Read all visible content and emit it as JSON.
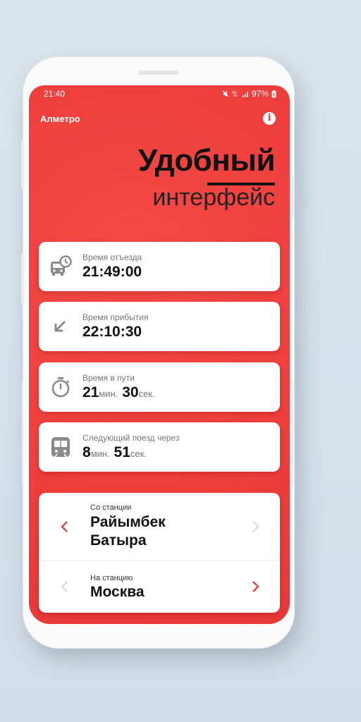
{
  "status_bar": {
    "time": "21:40",
    "battery": "97%"
  },
  "app": {
    "title": "Алметро"
  },
  "headline": {
    "line1": "Удобный",
    "line2": "интерфейс"
  },
  "cards": [
    {
      "icon": "bus-clock-icon",
      "label": "Время отъезда",
      "value": "21:49:00"
    },
    {
      "icon": "arrow-down-left-icon",
      "label": "Время прибытия",
      "value": "22:10:30"
    },
    {
      "icon": "stopwatch-icon",
      "label": "Время в пути",
      "minutes": "21",
      "min_unit": "мин.",
      "seconds": "30",
      "sec_unit": "сек."
    },
    {
      "icon": "train-icon",
      "label": "Следующий поезд через",
      "minutes": "8",
      "min_unit": "мин.",
      "seconds": "51",
      "sec_unit": "сек."
    }
  ],
  "stations": {
    "from": {
      "label": "Со станции",
      "name_line1": "Райымбек",
      "name_line2": "Батыра"
    },
    "to": {
      "label": "На станцию",
      "name": "Москва"
    }
  },
  "colors": {
    "accent": "#ee3e3c",
    "icon_gray": "#8a8a8a",
    "disabled_arrow": "#d6d6d6"
  }
}
